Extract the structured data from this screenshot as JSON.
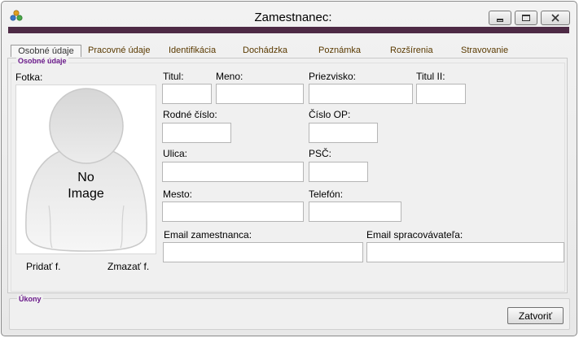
{
  "window": {
    "title": "Zamestnanec:"
  },
  "titlebar_buttons": {
    "minimize_icon": "minimize-icon",
    "maximize_icon": "maximize-icon",
    "close_icon": "close-icon"
  },
  "colors": {
    "accent_bar": "#4e2a45",
    "group_label": "#6a1a8a",
    "tab_text": "#5a3a00"
  },
  "tabs": [
    {
      "label": "Osobné údaje",
      "active": true
    },
    {
      "label": "Pracovné údaje"
    },
    {
      "label": "Identifikácia"
    },
    {
      "label": "Dochádzka"
    },
    {
      "label": "Poznámka"
    },
    {
      "label": "Rozšírenia"
    },
    {
      "label": "Stravovanie"
    }
  ],
  "personal": {
    "group_label": "Osobné údaje",
    "photo_label": "Fotka:",
    "photo_placeholder": {
      "line1": "No",
      "line2": "Image"
    },
    "add_photo": "Pridať f.",
    "delete_photo": "Zmazať f.",
    "fields": {
      "titul": {
        "label": "Titul:",
        "value": ""
      },
      "meno": {
        "label": "Meno:",
        "value": ""
      },
      "priezvisko": {
        "label": "Priezvisko:",
        "value": ""
      },
      "titul2": {
        "label": "Titul II:",
        "value": ""
      },
      "rodne_cislo": {
        "label": "Rodné číslo:",
        "value": ""
      },
      "cislo_op": {
        "label": "Číslo OP:",
        "value": ""
      },
      "ulica": {
        "label": "Ulica:",
        "value": ""
      },
      "psc": {
        "label": "PSČ:",
        "value": ""
      },
      "mesto": {
        "label": "Mesto:",
        "value": ""
      },
      "telefon": {
        "label": "Telefón:",
        "value": ""
      },
      "email_zam": {
        "label": "Email zamestnanca:",
        "value": ""
      },
      "email_sprac": {
        "label": "Email spracovávateľa:",
        "value": ""
      }
    }
  },
  "actions": {
    "group_label": "Úkony",
    "close_button": "Zatvoriť"
  }
}
